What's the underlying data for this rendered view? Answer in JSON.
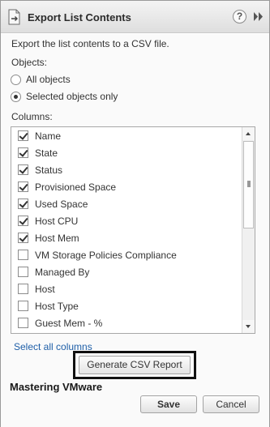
{
  "dialog": {
    "title": "Export List Contents",
    "help_icon": "?"
  },
  "description": "Export the list contents to a CSV file.",
  "objects": {
    "label": "Objects:",
    "options": [
      {
        "label": "All objects",
        "selected": false
      },
      {
        "label": "Selected objects only",
        "selected": true
      }
    ]
  },
  "columns": {
    "label": "Columns:",
    "items": [
      {
        "label": "Name",
        "checked": true
      },
      {
        "label": "State",
        "checked": true
      },
      {
        "label": "Status",
        "checked": true
      },
      {
        "label": "Provisioned Space",
        "checked": true
      },
      {
        "label": "Used Space",
        "checked": true
      },
      {
        "label": "Host CPU",
        "checked": true
      },
      {
        "label": "Host Mem",
        "checked": true
      },
      {
        "label": "VM Storage Policies Compliance",
        "checked": false
      },
      {
        "label": "Managed By",
        "checked": false
      },
      {
        "label": "Host",
        "checked": false
      },
      {
        "label": "Host Type",
        "checked": false
      },
      {
        "label": "Guest Mem - %",
        "checked": false
      }
    ]
  },
  "select_all_link": "Select all columns",
  "generate_button": "Generate CSV Report",
  "watermark": "Mastering VMware",
  "buttons": {
    "save": "Save",
    "cancel": "Cancel"
  }
}
